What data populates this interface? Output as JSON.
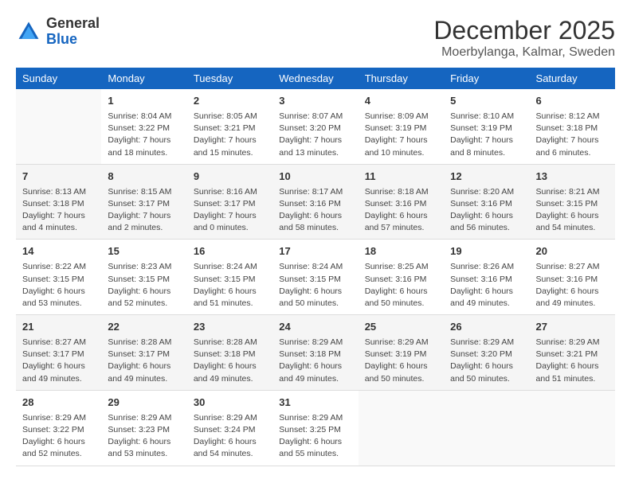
{
  "logo": {
    "general": "General",
    "blue": "Blue"
  },
  "title": "December 2025",
  "location": "Moerbylanga, Kalmar, Sweden",
  "days_header": [
    "Sunday",
    "Monday",
    "Tuesday",
    "Wednesday",
    "Thursday",
    "Friday",
    "Saturday"
  ],
  "weeks": [
    [
      {
        "day": "",
        "info": ""
      },
      {
        "day": "1",
        "info": "Sunrise: 8:04 AM\nSunset: 3:22 PM\nDaylight: 7 hours\nand 18 minutes."
      },
      {
        "day": "2",
        "info": "Sunrise: 8:05 AM\nSunset: 3:21 PM\nDaylight: 7 hours\nand 15 minutes."
      },
      {
        "day": "3",
        "info": "Sunrise: 8:07 AM\nSunset: 3:20 PM\nDaylight: 7 hours\nand 13 minutes."
      },
      {
        "day": "4",
        "info": "Sunrise: 8:09 AM\nSunset: 3:19 PM\nDaylight: 7 hours\nand 10 minutes."
      },
      {
        "day": "5",
        "info": "Sunrise: 8:10 AM\nSunset: 3:19 PM\nDaylight: 7 hours\nand 8 minutes."
      },
      {
        "day": "6",
        "info": "Sunrise: 8:12 AM\nSunset: 3:18 PM\nDaylight: 7 hours\nand 6 minutes."
      }
    ],
    [
      {
        "day": "7",
        "info": "Sunrise: 8:13 AM\nSunset: 3:18 PM\nDaylight: 7 hours\nand 4 minutes."
      },
      {
        "day": "8",
        "info": "Sunrise: 8:15 AM\nSunset: 3:17 PM\nDaylight: 7 hours\nand 2 minutes."
      },
      {
        "day": "9",
        "info": "Sunrise: 8:16 AM\nSunset: 3:17 PM\nDaylight: 7 hours\nand 0 minutes."
      },
      {
        "day": "10",
        "info": "Sunrise: 8:17 AM\nSunset: 3:16 PM\nDaylight: 6 hours\nand 58 minutes."
      },
      {
        "day": "11",
        "info": "Sunrise: 8:18 AM\nSunset: 3:16 PM\nDaylight: 6 hours\nand 57 minutes."
      },
      {
        "day": "12",
        "info": "Sunrise: 8:20 AM\nSunset: 3:16 PM\nDaylight: 6 hours\nand 56 minutes."
      },
      {
        "day": "13",
        "info": "Sunrise: 8:21 AM\nSunset: 3:15 PM\nDaylight: 6 hours\nand 54 minutes."
      }
    ],
    [
      {
        "day": "14",
        "info": "Sunrise: 8:22 AM\nSunset: 3:15 PM\nDaylight: 6 hours\nand 53 minutes."
      },
      {
        "day": "15",
        "info": "Sunrise: 8:23 AM\nSunset: 3:15 PM\nDaylight: 6 hours\nand 52 minutes."
      },
      {
        "day": "16",
        "info": "Sunrise: 8:24 AM\nSunset: 3:15 PM\nDaylight: 6 hours\nand 51 minutes."
      },
      {
        "day": "17",
        "info": "Sunrise: 8:24 AM\nSunset: 3:15 PM\nDaylight: 6 hours\nand 50 minutes."
      },
      {
        "day": "18",
        "info": "Sunrise: 8:25 AM\nSunset: 3:16 PM\nDaylight: 6 hours\nand 50 minutes."
      },
      {
        "day": "19",
        "info": "Sunrise: 8:26 AM\nSunset: 3:16 PM\nDaylight: 6 hours\nand 49 minutes."
      },
      {
        "day": "20",
        "info": "Sunrise: 8:27 AM\nSunset: 3:16 PM\nDaylight: 6 hours\nand 49 minutes."
      }
    ],
    [
      {
        "day": "21",
        "info": "Sunrise: 8:27 AM\nSunset: 3:17 PM\nDaylight: 6 hours\nand 49 minutes."
      },
      {
        "day": "22",
        "info": "Sunrise: 8:28 AM\nSunset: 3:17 PM\nDaylight: 6 hours\nand 49 minutes."
      },
      {
        "day": "23",
        "info": "Sunrise: 8:28 AM\nSunset: 3:18 PM\nDaylight: 6 hours\nand 49 minutes."
      },
      {
        "day": "24",
        "info": "Sunrise: 8:29 AM\nSunset: 3:18 PM\nDaylight: 6 hours\nand 49 minutes."
      },
      {
        "day": "25",
        "info": "Sunrise: 8:29 AM\nSunset: 3:19 PM\nDaylight: 6 hours\nand 50 minutes."
      },
      {
        "day": "26",
        "info": "Sunrise: 8:29 AM\nSunset: 3:20 PM\nDaylight: 6 hours\nand 50 minutes."
      },
      {
        "day": "27",
        "info": "Sunrise: 8:29 AM\nSunset: 3:21 PM\nDaylight: 6 hours\nand 51 minutes."
      }
    ],
    [
      {
        "day": "28",
        "info": "Sunrise: 8:29 AM\nSunset: 3:22 PM\nDaylight: 6 hours\nand 52 minutes."
      },
      {
        "day": "29",
        "info": "Sunrise: 8:29 AM\nSunset: 3:23 PM\nDaylight: 6 hours\nand 53 minutes."
      },
      {
        "day": "30",
        "info": "Sunrise: 8:29 AM\nSunset: 3:24 PM\nDaylight: 6 hours\nand 54 minutes."
      },
      {
        "day": "31",
        "info": "Sunrise: 8:29 AM\nSunset: 3:25 PM\nDaylight: 6 hours\nand 55 minutes."
      },
      {
        "day": "",
        "info": ""
      },
      {
        "day": "",
        "info": ""
      },
      {
        "day": "",
        "info": ""
      }
    ]
  ]
}
